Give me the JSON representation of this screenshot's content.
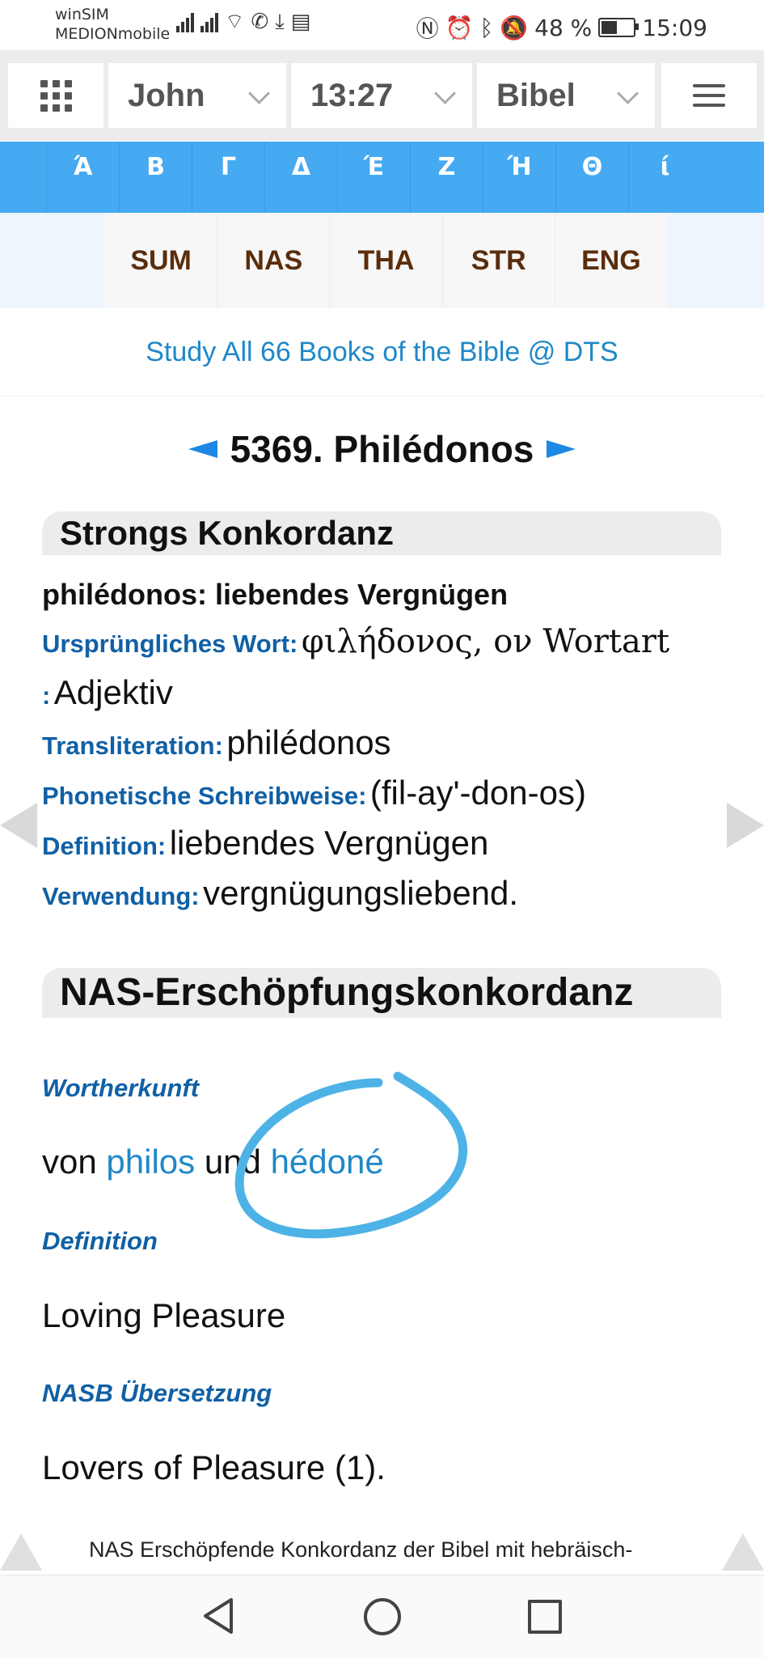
{
  "status_bar": {
    "carrier_line1": "winSIM",
    "carrier_line2": "MEDIONmobile",
    "battery_text": "48 %",
    "battery_level": 0.48,
    "time": "15:09"
  },
  "top_nav": {
    "book": "John",
    "verse": "13:27",
    "version": "Bibel"
  },
  "greek_letters": [
    "Ά",
    "Β",
    "Γ",
    "Δ",
    "Έ",
    "Ζ",
    "Ή",
    "Θ",
    "ί"
  ],
  "tabs": [
    "SUM",
    "NAS",
    "THA",
    "STR",
    "ENG"
  ],
  "dts_link": "Study All 66 Books of the Bible @ DTS",
  "title": "5369. Philédonos",
  "strongs": {
    "header": "Strongs Konkordanz",
    "headline": "philédonos: liebendes Vergnügen",
    "original_label": "Ursprüngliches Wort:",
    "original_value": "φιλήδονος, ον Wortart",
    "pos_label": ":",
    "pos_value": "Adjektiv",
    "translit_label": "Transliteration:",
    "translit_value": "philédonos",
    "phonetic_label": "Phonetische Schreibweise:",
    "phonetic_value": "(fil-ay'-don-os)",
    "definition_label": "Definition:",
    "definition_value": "liebendes Vergnügen",
    "usage_label": "Verwendung:",
    "usage_value": "vergnügungsliebend."
  },
  "nas": {
    "header": "NAS-Erschöpfungskonkordanz",
    "origin_label": "Wortherkunft",
    "origin_prefix": "von",
    "origin_link1": "philos",
    "origin_mid": "und",
    "origin_link2": "hédoné",
    "definition_label": "Definition",
    "definition_value": "Loving Pleasure",
    "nasb_label": "NASB Übersetzung",
    "nasb_value": "Lovers of Pleasure (1)."
  },
  "footer_text": "NAS Erschöpfende Konkordanz der Bibel mit hebräisch-",
  "colors": {
    "greek_bar": "#45aaf2",
    "tab_text": "#5a2d0c",
    "label_blue": "#1060a5",
    "link_blue": "#1f88c8",
    "annotation": "#4db3e6"
  }
}
